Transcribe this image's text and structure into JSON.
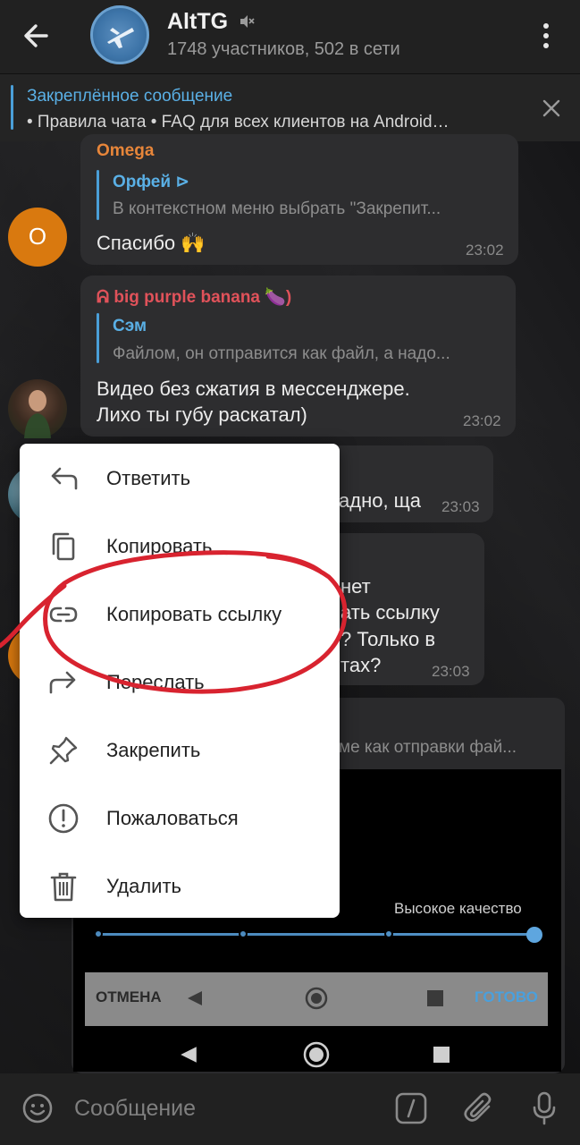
{
  "header": {
    "title": "AltTG",
    "subtitle": "1748 участников, 502 в сети",
    "icons": [
      "back-arrow-icon",
      "mute-icon",
      "more-vert-icon"
    ]
  },
  "pinned": {
    "title": "Закреплённое сообщение",
    "text": "• Правила чата  • FAQ для всех клиентов на Android…"
  },
  "messages": [
    {
      "author": "Omega",
      "author_color": "#e8863a",
      "avatar_letter": "O",
      "avatar_color": "#d9790f",
      "reply_name": "Орфей ⊳",
      "reply_text": "В контекстном меню выбрать \"Закрепит...",
      "text": "Спасибо 🙌",
      "time": "23:02"
    },
    {
      "author": "ᕱ big purple banana 🍆)",
      "author_color": "#e0525a",
      "reply_name": "Сэм",
      "reply_text": "Файлом, он отправится как файл, а надо...",
      "text_line1": "Видео без сжатия в мессенджере.",
      "text_line2": "Лихо ты губу раскатал)",
      "time": "23:02"
    },
    {
      "text": "адно, ща",
      "time": "23:03"
    },
    {
      "text_line1": "нет",
      "text_line2": "ать ссылку",
      "text_line3": "? Только в",
      "text_line4": "тах?",
      "time": "23:03"
    },
    {
      "reply_text": "ме как отправки фай..."
    }
  ],
  "context_menu": {
    "items": [
      {
        "label": "Ответить",
        "icon": "reply-icon"
      },
      {
        "label": "Копировать",
        "icon": "copy-icon"
      },
      {
        "label": "Копировать ссылку",
        "icon": "link-icon"
      },
      {
        "label": "Переслать",
        "icon": "forward-icon"
      },
      {
        "label": "Закрепить",
        "icon": "pin-icon"
      },
      {
        "label": "Пожаловаться",
        "icon": "report-icon"
      },
      {
        "label": "Удалить",
        "icon": "delete-icon"
      }
    ]
  },
  "video_editor": {
    "quality_label": "Высокое качество",
    "quality_level": 1.0,
    "cancel_label": "ОТМЕНА",
    "done_label": "ГОТОВО"
  },
  "composer": {
    "placeholder": "Сообщение",
    "icons": [
      "emoji-icon",
      "bot-command-icon",
      "attach-icon",
      "mic-icon"
    ]
  },
  "colors": {
    "accent": "#4a9fd8",
    "annotation_circle": "#d8232f",
    "menu_bg": "#ffffff"
  }
}
